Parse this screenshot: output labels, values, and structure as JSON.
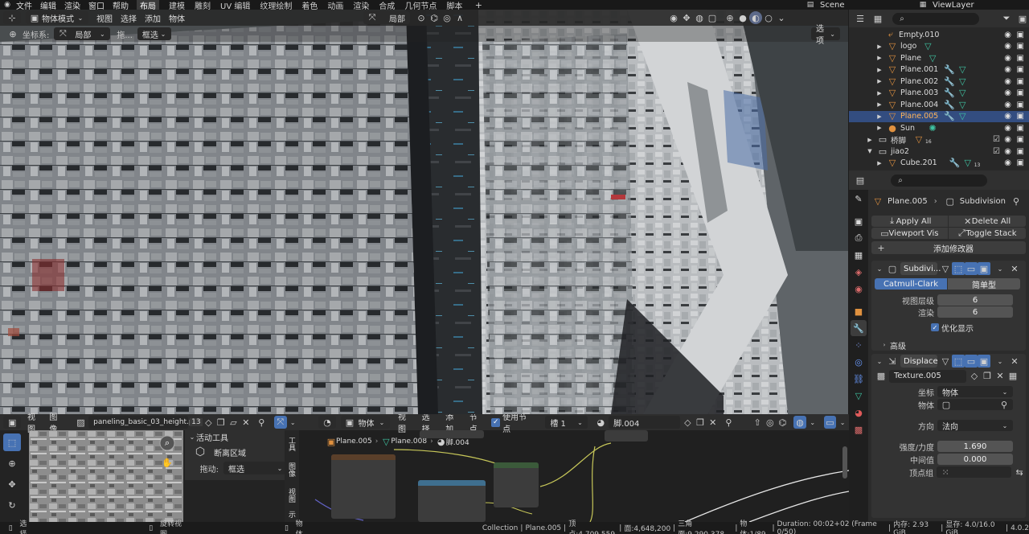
{
  "topbar": {
    "menus": [
      "文件",
      "编辑",
      "渲染",
      "窗口",
      "帮助"
    ],
    "workspaces": [
      "布局",
      "建模",
      "雕刻",
      "UV 编辑",
      "纹理绘制",
      "着色",
      "动画",
      "渲染",
      "合成",
      "几何节点",
      "脚本"
    ],
    "active_workspace": "布局",
    "scene": "Scene",
    "view_layer": "ViewLayer"
  },
  "viewport": {
    "mode": "物体模式",
    "menus": [
      "视图",
      "选择",
      "添加",
      "物体"
    ],
    "transform_orientation": "局部",
    "coord_label": "坐标系:",
    "coord_value": "局部",
    "drag_label": "拖...",
    "drag_value": "框选",
    "options_label": "选项"
  },
  "outliner": {
    "search_placeholder": "",
    "rows": [
      {
        "name": "Empty.010",
        "selected": false
      },
      {
        "name": "logo",
        "selected": false
      },
      {
        "name": "Plane",
        "selected": false
      },
      {
        "name": "Plane.001",
        "selected": false
      },
      {
        "name": "Plane.002",
        "selected": false
      },
      {
        "name": "Plane.003",
        "selected": false
      },
      {
        "name": "Plane.004",
        "selected": false
      },
      {
        "name": "Plane.005",
        "selected": true
      },
      {
        "name": "Sun",
        "selected": false
      },
      {
        "name": "桥脚",
        "selected": false,
        "badge": "16"
      },
      {
        "name": "jiao2",
        "selected": false
      },
      {
        "name": "Cube.201",
        "selected": false,
        "badge": "13"
      }
    ]
  },
  "properties": {
    "breadcrumb_object": "Plane.005",
    "breadcrumb_modifier": "Subdivision",
    "apply_all": "Apply All",
    "delete_all": "Delete All",
    "viewport_vis": "Viewport Vis",
    "toggle_stack": "Toggle Stack",
    "add_modifier": "添加修改器",
    "subdiv": {
      "name": "Subdivi...",
      "tab_catmull": "Catmull-Clark",
      "tab_simple": "简单型",
      "viewport_levels_label": "视图层级",
      "viewport_levels": "6",
      "render_label": "渲染",
      "render": "6",
      "optimal_label": "优化显示",
      "advanced_label": "高级"
    },
    "displace": {
      "name": "Displace",
      "texture": "Texture.005",
      "coords_label": "坐标",
      "coords_value": "物体",
      "object_label": "物体",
      "direction_label": "方向",
      "direction_value": "法向",
      "strength_label": "强度/力度",
      "strength": "1.690",
      "midlevel_label": "中间值",
      "midlevel": "0.000",
      "vgroup_label": "顶点组"
    }
  },
  "image_editor": {
    "menus": [
      "视图",
      "图像"
    ],
    "image_name": "paneling_basic_03_height.png",
    "users": "13",
    "active_tool_label": "活动工具",
    "tool_name": "断离区域",
    "drag_label": "拖动:",
    "drag_value": "框选",
    "side_tabs": [
      "工具",
      "图像",
      "视图",
      "示"
    ]
  },
  "node_editor": {
    "type": "物体",
    "menus": [
      "视图",
      "选择",
      "添加",
      "节点"
    ],
    "use_nodes_label": "使用节点",
    "slot": "槽 1",
    "material": "脚.004",
    "breadcrumb": [
      "Plane.005",
      "Plane.008",
      "脚.004"
    ]
  },
  "status": {
    "select": "选择",
    "rotate_view": "旋转视图",
    "object": "物体",
    "collection": "Collection",
    "active": "Plane.005",
    "verts": "顶点:4,709,559",
    "faces": "面:4,648,200",
    "tris": "三角面:9,290,378",
    "objects": "物体:1/89",
    "duration": "Duration: 00:02+02 (Frame 0/50)",
    "memory": "内存: 2.93 GiB",
    "vram": "显存: 4.0/16.0 GiB",
    "version": "4.0.2"
  }
}
